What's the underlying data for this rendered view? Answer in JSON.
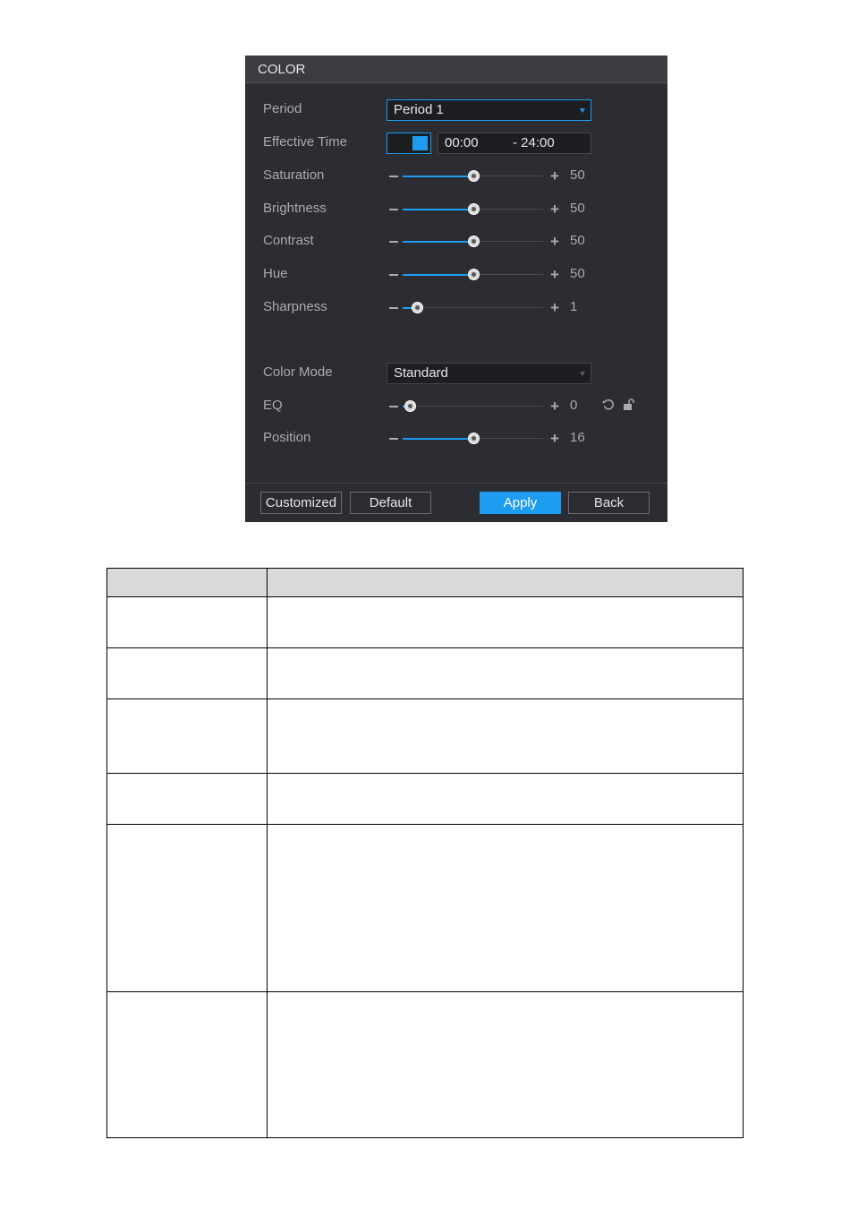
{
  "dialog": {
    "title": "COLOR",
    "period": {
      "label": "Period",
      "value": "Period 1"
    },
    "effective_time": {
      "label": "Effective Time",
      "enabled": true,
      "start": "00:00",
      "end": "- 24:00"
    },
    "sliders": [
      {
        "label": "Saturation",
        "value": "50",
        "level": 0.5
      },
      {
        "label": "Brightness",
        "value": "50",
        "level": 0.5
      },
      {
        "label": "Contrast",
        "value": "50",
        "level": 0.5
      },
      {
        "label": "Hue",
        "value": "50",
        "level": 0.5
      },
      {
        "label": "Sharpness",
        "value": "1",
        "level": 0.1
      }
    ],
    "color_mode": {
      "label": "Color Mode",
      "value": "Standard"
    },
    "eq": {
      "label": "EQ",
      "value": "0",
      "level": 0.05
    },
    "position": {
      "label": "Position",
      "value": "16",
      "level": 0.5
    },
    "minus_symbol": "−",
    "plus_symbol": "+",
    "buttons": {
      "customized": "Customized",
      "default": "Default",
      "apply": "Apply",
      "back": "Back"
    },
    "icons": [
      "minus-icon",
      "plus-icon",
      "refresh-icon",
      "unlock-icon",
      "dropdown-arrow-icon"
    ],
    "colors": {
      "accent": "#1e9cf0",
      "panel": "#2b2d33",
      "header": "#3a3c42"
    }
  },
  "table": {
    "columns": [
      "",
      ""
    ],
    "rows": [
      [
        "",
        ""
      ],
      [
        "",
        ""
      ],
      [
        "",
        ""
      ],
      [
        "",
        ""
      ],
      [
        "",
        ""
      ],
      [
        "",
        ""
      ]
    ]
  }
}
